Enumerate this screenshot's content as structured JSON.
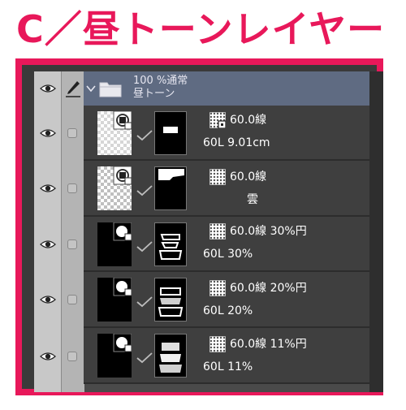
{
  "title": "C／昼トーンレイヤー",
  "folder": {
    "line1": "100 %通常",
    "line2": "昼トーン"
  },
  "layers": [
    {
      "line1": "60.0線",
      "line2": "60L 9.01cm"
    },
    {
      "line1": "60.0線",
      "line2": "雲"
    },
    {
      "line1": "60.0線 30%円",
      "line2": "60L 30%"
    },
    {
      "line1": "60.0線 20%円",
      "line2": "60L 20%"
    },
    {
      "line1": "60.0線 11%円",
      "line2": "60L 11%"
    }
  ],
  "colors": {
    "accent": "#e8185a",
    "folder_row": "#5f6b82",
    "layer_row": "#3f3f3f"
  },
  "icons": [
    "eye-icon",
    "pen-icon",
    "chevron-down-icon",
    "folder-icon",
    "layer-thumbnail",
    "link-check-icon",
    "layer-mask-thumbnail",
    "tone-icon"
  ]
}
